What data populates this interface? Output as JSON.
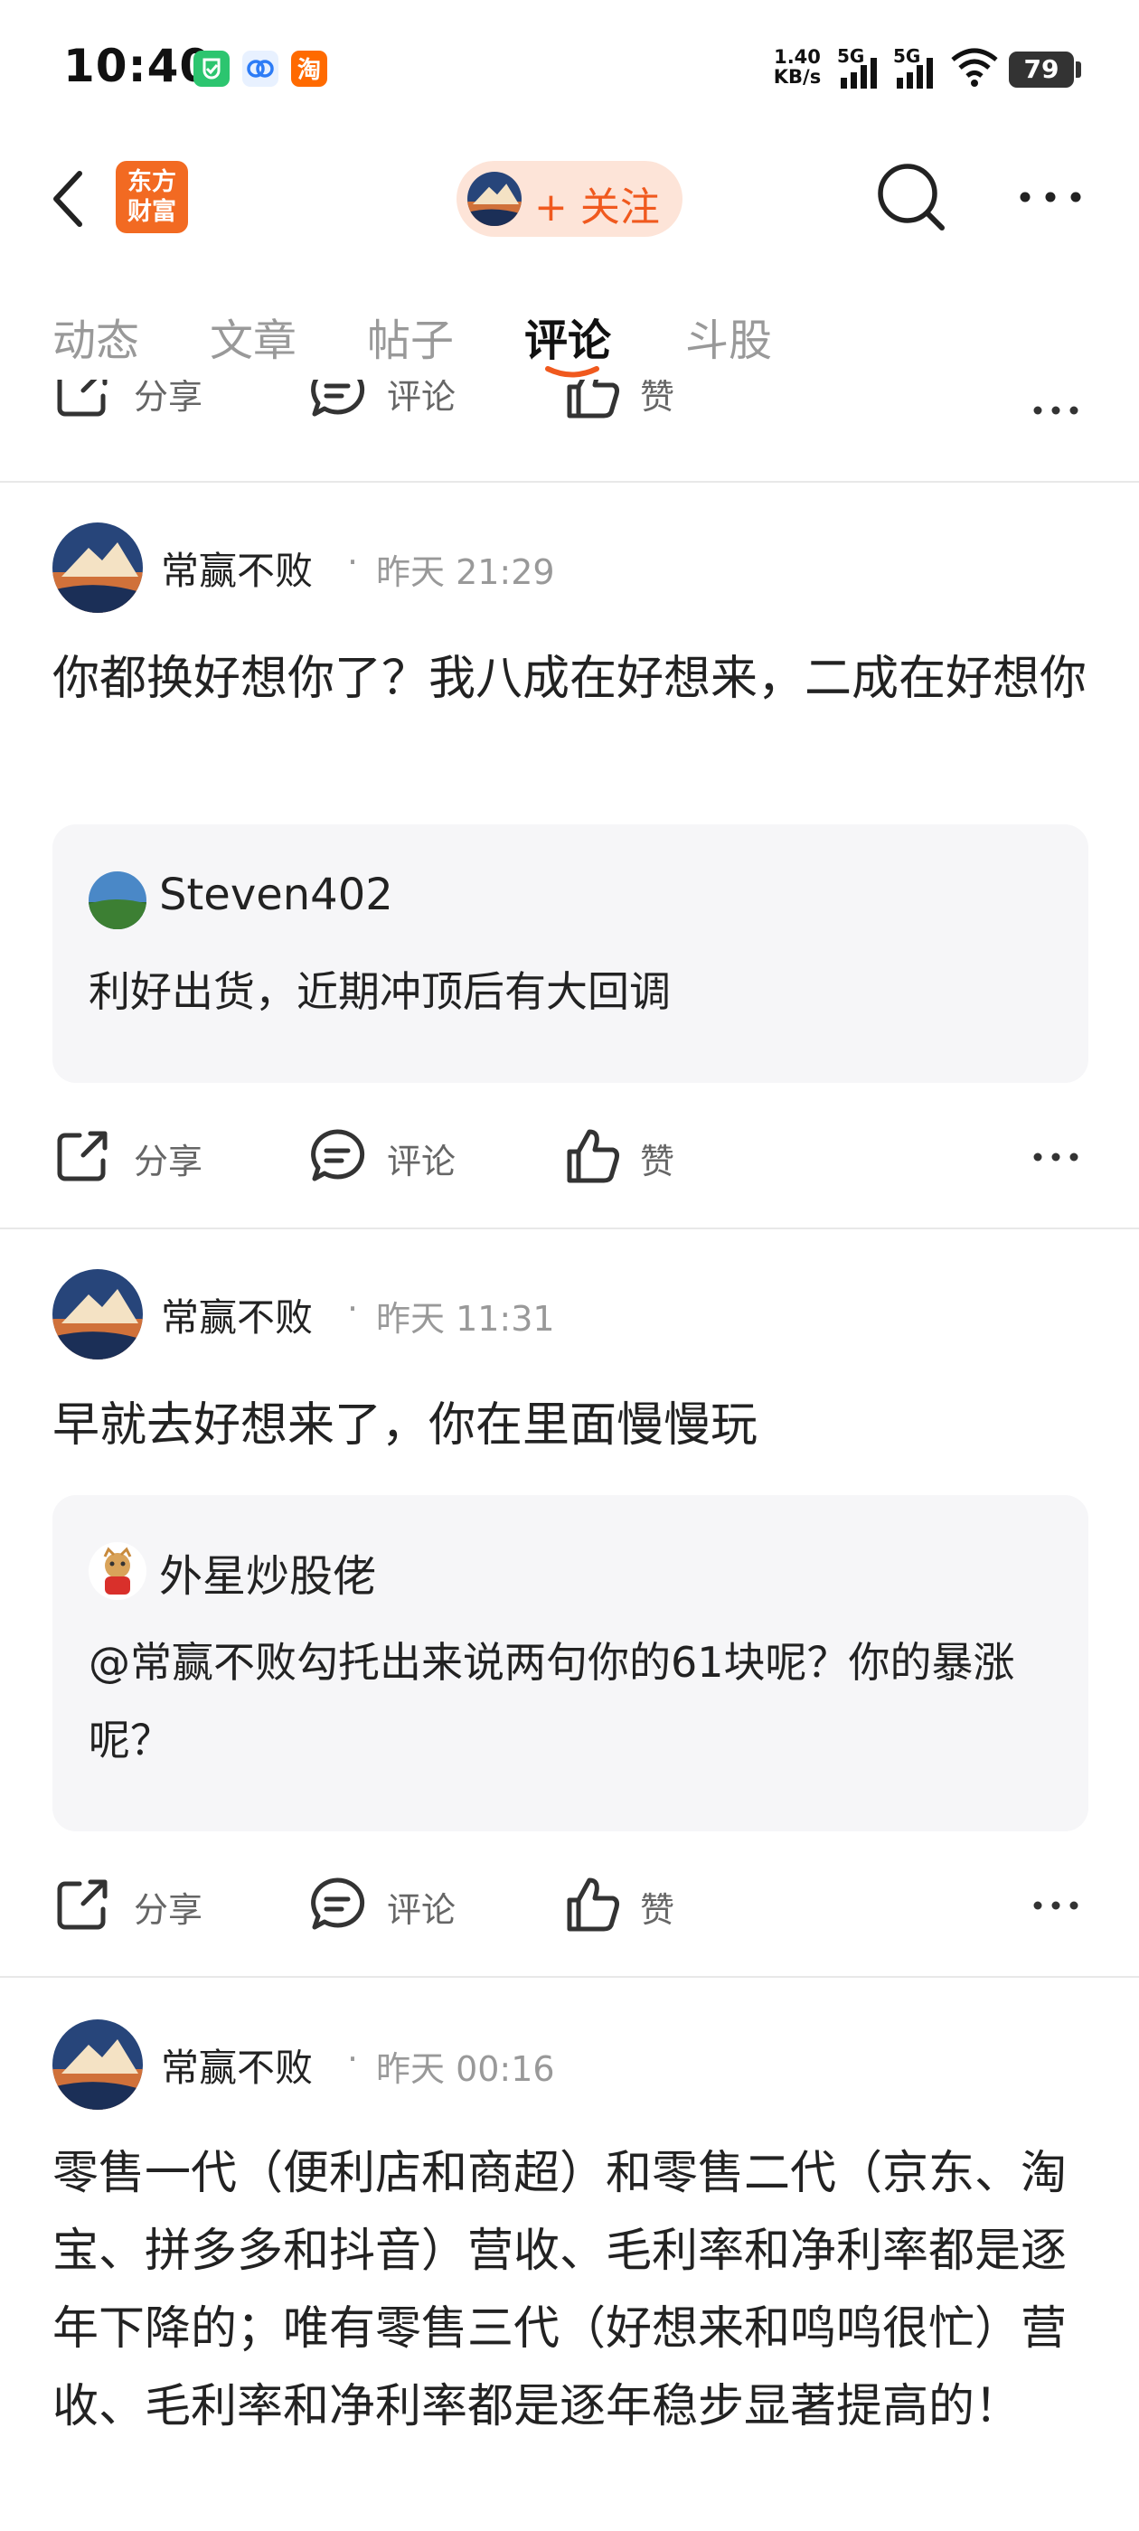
{
  "status_bar": {
    "time": "10:40",
    "notif_icons": [
      "shield-app-icon",
      "browser-app-icon",
      "taobao-app-icon"
    ],
    "net_speed_value": "1.40",
    "net_speed_unit": "KB/s",
    "signal1_label": "5G",
    "signal2_label": "5G",
    "battery": "79"
  },
  "header": {
    "logo_line1": "东方",
    "logo_line2": "财富",
    "follow_label": "+ 关注"
  },
  "tabs": [
    {
      "label": "动态"
    },
    {
      "label": "文章"
    },
    {
      "label": "帖子"
    },
    {
      "label": "评论"
    },
    {
      "label": "斗股"
    }
  ],
  "actions": {
    "share": "分享",
    "comment": "评论",
    "like": "赞"
  },
  "posts": [
    {
      "author": "常赢不败",
      "time": "昨天 21:29",
      "text": "你都换好想你了？我八成在好想来，二成在好想你",
      "quote": {
        "name": "Steven402",
        "text": "利好出货，近期冲顶后有大回调"
      }
    },
    {
      "author": "常赢不败",
      "time": "昨天 11:31",
      "text": "早就去好想来了，你在里面慢慢玩",
      "quote": {
        "name": "外星炒股佬",
        "text": "@常赢不败勾托出来说两句你的61块呢？你的暴涨呢？"
      }
    },
    {
      "author": "常赢不败",
      "time": "昨天 00:16",
      "text": "零售一代（便利店和商超）和零售二代（京东、淘宝、拼多多和抖音）营收、毛利率和净利率都是逐年下降的；唯有零售三代（好想来和鸣鸣很忙）营收、毛利率和净利率都是逐年稳步显著提高的！"
    }
  ],
  "colors": {
    "accent": "#f0591e",
    "follow_bg": "#fde4d8",
    "quote_bg": "#f6f6f8",
    "muted": "#999999"
  }
}
